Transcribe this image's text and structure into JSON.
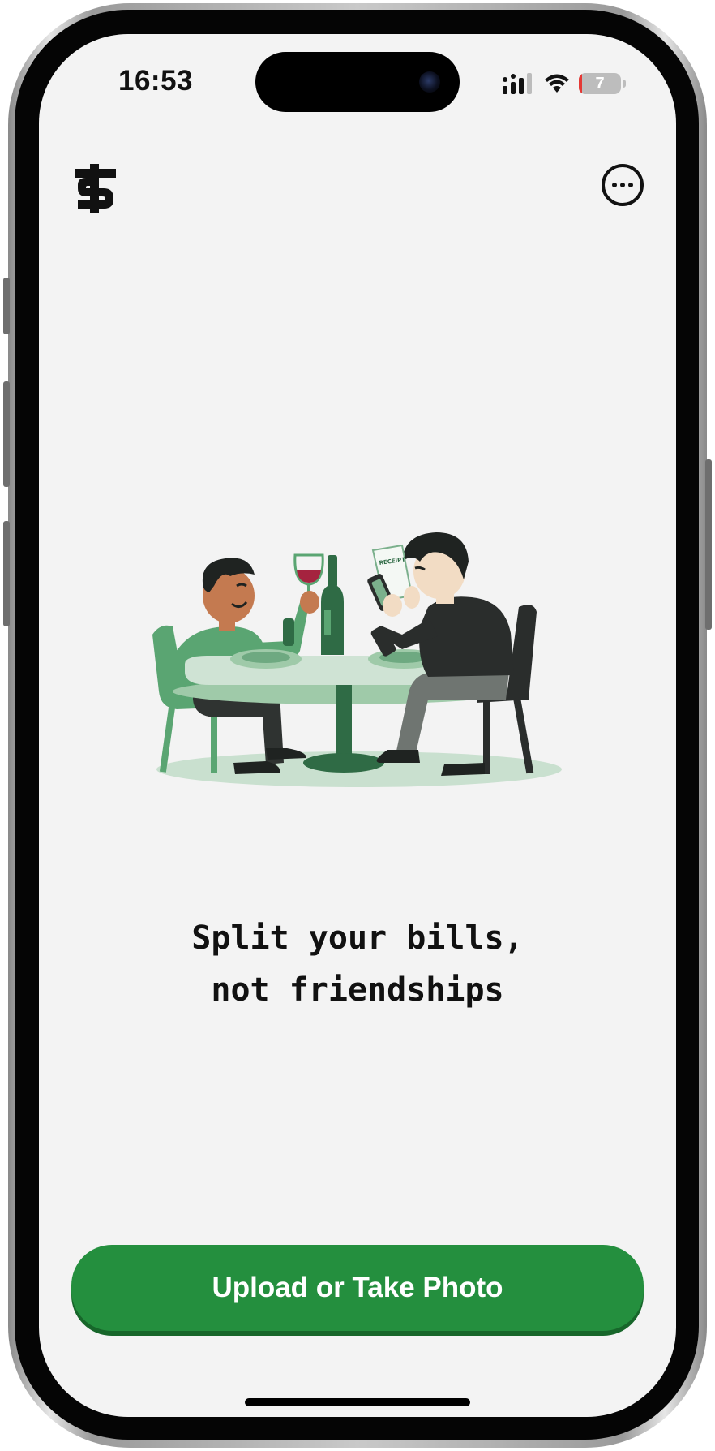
{
  "status_bar": {
    "time": "16:53",
    "battery_level": "7",
    "icons": [
      "signal-icon",
      "wifi-icon",
      "battery-icon"
    ]
  },
  "header": {
    "logo_icon": "dollar-logo-icon",
    "menu_icon": "more-options-icon"
  },
  "hero": {
    "illustration": "two-people-at-dinner-table-illustration",
    "receipt_label": "RECEIPT"
  },
  "tagline": {
    "line1": "Split your bills,",
    "line2": "not friendships"
  },
  "actions": {
    "primary_label": "Upload or Take Photo"
  },
  "colors": {
    "accent": "#248f3e",
    "background": "#f3f3f3",
    "text": "#111111",
    "illustration_green": "#5aa572"
  }
}
